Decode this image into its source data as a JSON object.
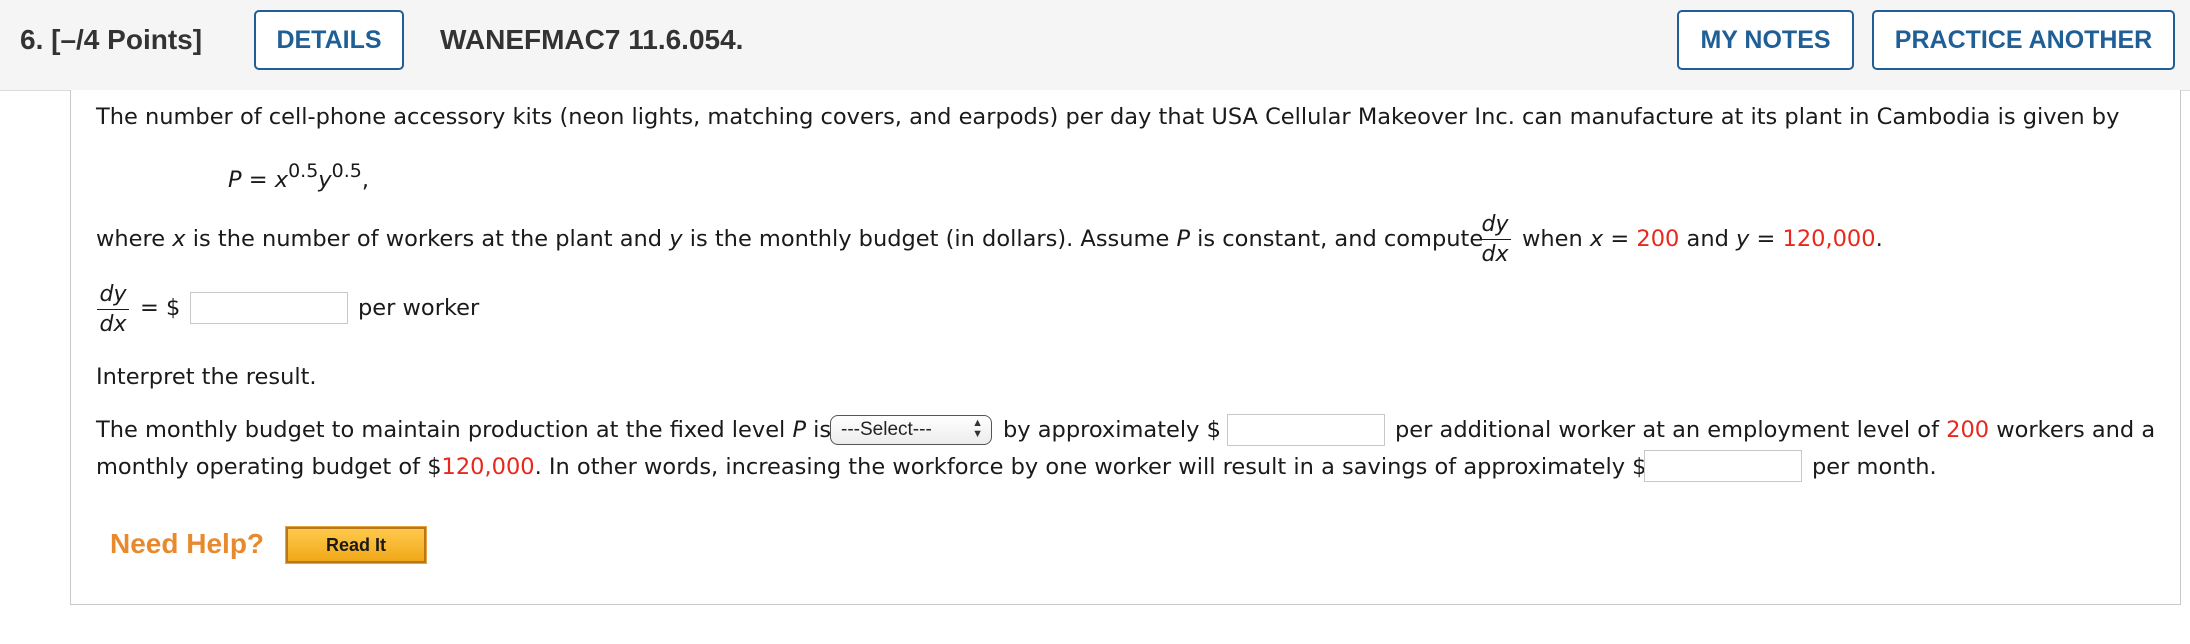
{
  "header": {
    "question_label": "6. [–/4 Points]",
    "details_label": "DETAILS",
    "question_id": "WANEFMAC7 11.6.054.",
    "my_notes_label": "MY NOTES",
    "practice_label": "PRACTICE ANOTHER"
  },
  "problem": {
    "intro": "The number of cell-phone accessory kits (neon lights, matching covers, and earpods) per day that USA Cellular Makeover Inc. can manufacture at its plant in Cambodia is given by",
    "formula": {
      "lhs": "P",
      "eq": " = ",
      "x": "x",
      "x_exp": "0.5",
      "y": "y",
      "y_exp": "0.5",
      "trail": ","
    },
    "where": {
      "t1": "where ",
      "x": "x",
      "t2": " is the number of workers at the plant and ",
      "y": "y",
      "t3": " is the monthly budget (in dollars). Assume ",
      "p": "P",
      "t4": " is constant, and compute",
      "t5": "when ",
      "x2": "x",
      "t6": " = ",
      "x_val": "200",
      "t7": " and ",
      "y2": "y",
      "t8": " = ",
      "y_val": "120,000",
      "t9": "."
    },
    "frac_num": "dy",
    "frac_den": "dx",
    "answer_prefix": "= $",
    "answer_suffix": "per worker",
    "interpret": "Interpret the result."
  },
  "interpretation": {
    "a1": "The monthly budget to maintain production at the fixed level ",
    "a_p": "P",
    "a2": " is",
    "select_value": "---Select---",
    "a3": "by approximately $",
    "a4": "per additional worker at an employment level of ",
    "workers": "200",
    "a5": " workers and a",
    "b1": "monthly operating budget of $",
    "budget": "120,000",
    "b2": ". In other words, increasing the workforce by one worker will result in a savings of approximately $",
    "b3": "per month."
  },
  "help": {
    "need_help": "Need Help?",
    "read_it": "Read It"
  },
  "colors": {
    "accent": "#1f5f96",
    "highlight": "#e8281e",
    "help": "#e8892e"
  }
}
